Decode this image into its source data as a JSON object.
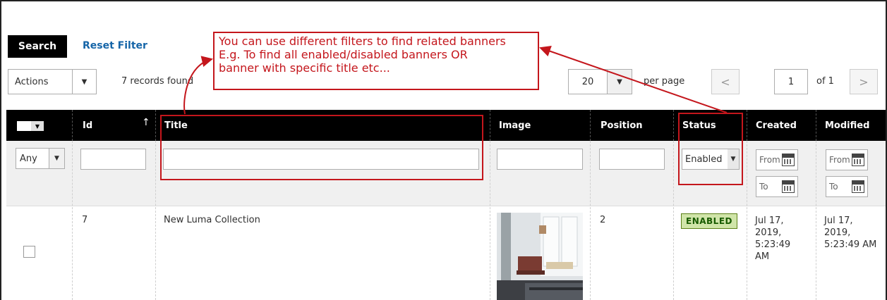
{
  "toolbar": {
    "search_label": "Search",
    "reset_filter_label": "Reset Filter",
    "actions_label": "Actions",
    "records_found": "7 records found",
    "per_page_value": "20",
    "per_page_label": "per page",
    "page_prev": "<",
    "page_current": "1",
    "page_of": "of 1",
    "page_next": ">"
  },
  "callout": {
    "lines": [
      "You can use different filters to find related banners",
      "E.g. To find all enabled/disabled banners OR",
      "banner with specific title etc..."
    ],
    "color": "#c4161c"
  },
  "columns": {
    "id": "Id",
    "sort_arrow": "↑",
    "title": "Title",
    "image": "Image",
    "position": "Position",
    "status": "Status",
    "created": "Created",
    "modified": "Modified"
  },
  "filters": {
    "mass_select": "Any",
    "status_select": "Enabled",
    "created_from": "From",
    "created_to": "To",
    "modified_from": "From",
    "modified_to": "To"
  },
  "rows": [
    {
      "id": "7",
      "title": "New Luma Collection",
      "position": "2",
      "status": "ENABLED",
      "created": [
        "Jul 17,",
        "2019,",
        "5:23:49",
        "AM"
      ],
      "modified": [
        "Jul 17,",
        "2019,",
        "5:23:49 AM"
      ]
    }
  ],
  "colors": {
    "header_bg": "#000000",
    "link": "#1565a8",
    "enabled_bg": "#d0e5a9",
    "enabled_text": "#185b00"
  }
}
